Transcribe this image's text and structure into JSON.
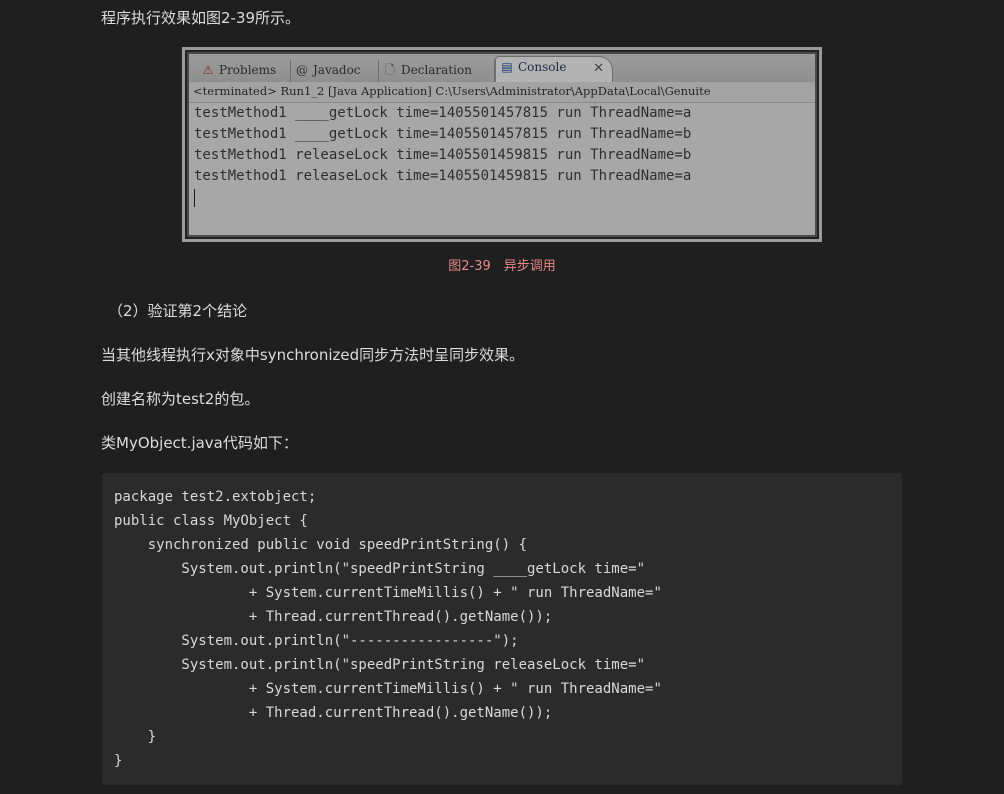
{
  "intro_text": "程序执行效果如图2-39所示。",
  "figure": {
    "tabs": [
      {
        "label": "Problems",
        "icon": "problems-icon"
      },
      {
        "label": "Javadoc",
        "icon": "javadoc-icon"
      },
      {
        "label": "Declaration",
        "icon": "declaration-icon"
      },
      {
        "label": "Console",
        "icon": "console-icon",
        "active": true
      }
    ],
    "close_glyph": "✕",
    "terminated_line": "<terminated> Run1_2 [Java Application] C:\\Users\\Administrator\\AppData\\Local\\Genuite",
    "console_lines": [
      "testMethod1 ____getLock time=1405501457815 run ThreadName=a",
      "testMethod1 ____getLock time=1405501457815 run ThreadName=b",
      "testMethod1 releaseLock time=1405501459815 run ThreadName=b",
      "testMethod1 releaseLock time=1405501459815 run ThreadName=a"
    ]
  },
  "caption": "图2-39　异步调用",
  "section_heading": "（2）验证第2个结论",
  "paragraph_1": "当其他线程执行x对象中synchronized同步方法时呈同步效果。",
  "paragraph_2": "创建名称为test2的包。",
  "paragraph_3": "类MyObject.java代码如下：",
  "code_lines": [
    "package test2.extobject;",
    "public class MyObject {",
    "    synchronized public void speedPrintString() {",
    "        System.out.println(\"speedPrintString ____getLock time=\"",
    "                + System.currentTimeMillis() + \" run ThreadName=\"",
    "                + Thread.currentThread().getName());",
    "        System.out.println(\"-----------------\");",
    "        System.out.println(\"speedPrintString releaseLock time=\"",
    "                + System.currentTimeMillis() + \" run ThreadName=\"",
    "                + Thread.currentThread().getName());",
    "    }",
    "}"
  ],
  "colors": {
    "background": "#1f1f1f",
    "text": "#dcdcdc",
    "caption": "#e58a8a",
    "code_background": "#2b2b2b"
  }
}
